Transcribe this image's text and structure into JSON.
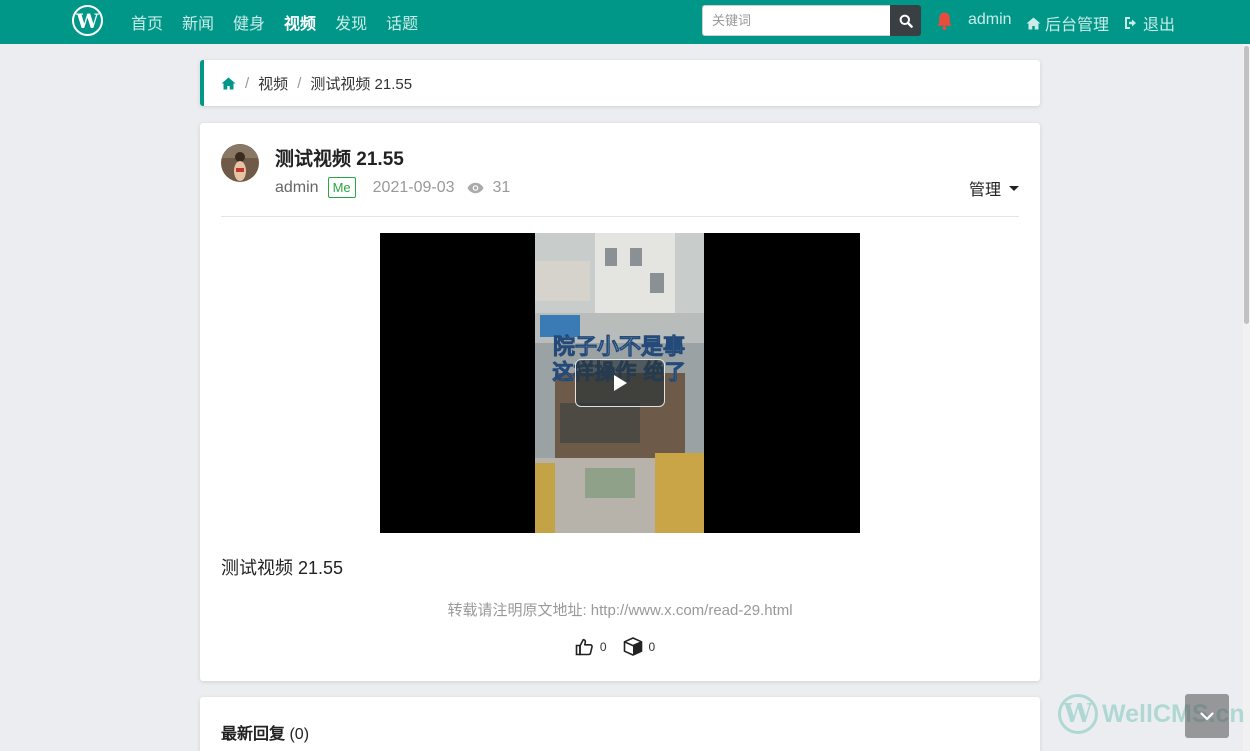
{
  "nav": {
    "logo_letter": "W",
    "links": [
      {
        "label": "首页"
      },
      {
        "label": "新闻"
      },
      {
        "label": "健身"
      },
      {
        "label": "视频",
        "active": true
      },
      {
        "label": "发现"
      },
      {
        "label": "话题"
      }
    ],
    "search_placeholder": "关键词",
    "user": "admin",
    "admin_label": "后台管理",
    "logout_label": "退出",
    "accent_color": "#009688"
  },
  "breadcrumb": {
    "items": [
      "视频",
      "测试视频 21.55"
    ]
  },
  "post": {
    "title": "测试视频 21.55",
    "author": "admin",
    "badge": "Me",
    "date": "2021-09-03",
    "views": "31",
    "manage_label": "管理",
    "video_caption_line1": "院子小不是事",
    "video_caption_line2": "这样操作 绝了",
    "body": "测试视频 21.55",
    "notice_prefix": "转载请注明原文地址: ",
    "notice_url": "http://www.x.com/read-29.html",
    "likes": "0",
    "favorites": "0"
  },
  "replies": {
    "title": "最新回复",
    "count": "(0)"
  },
  "watermark": {
    "logo_letter": "W",
    "text": "WellCMS.cn"
  }
}
